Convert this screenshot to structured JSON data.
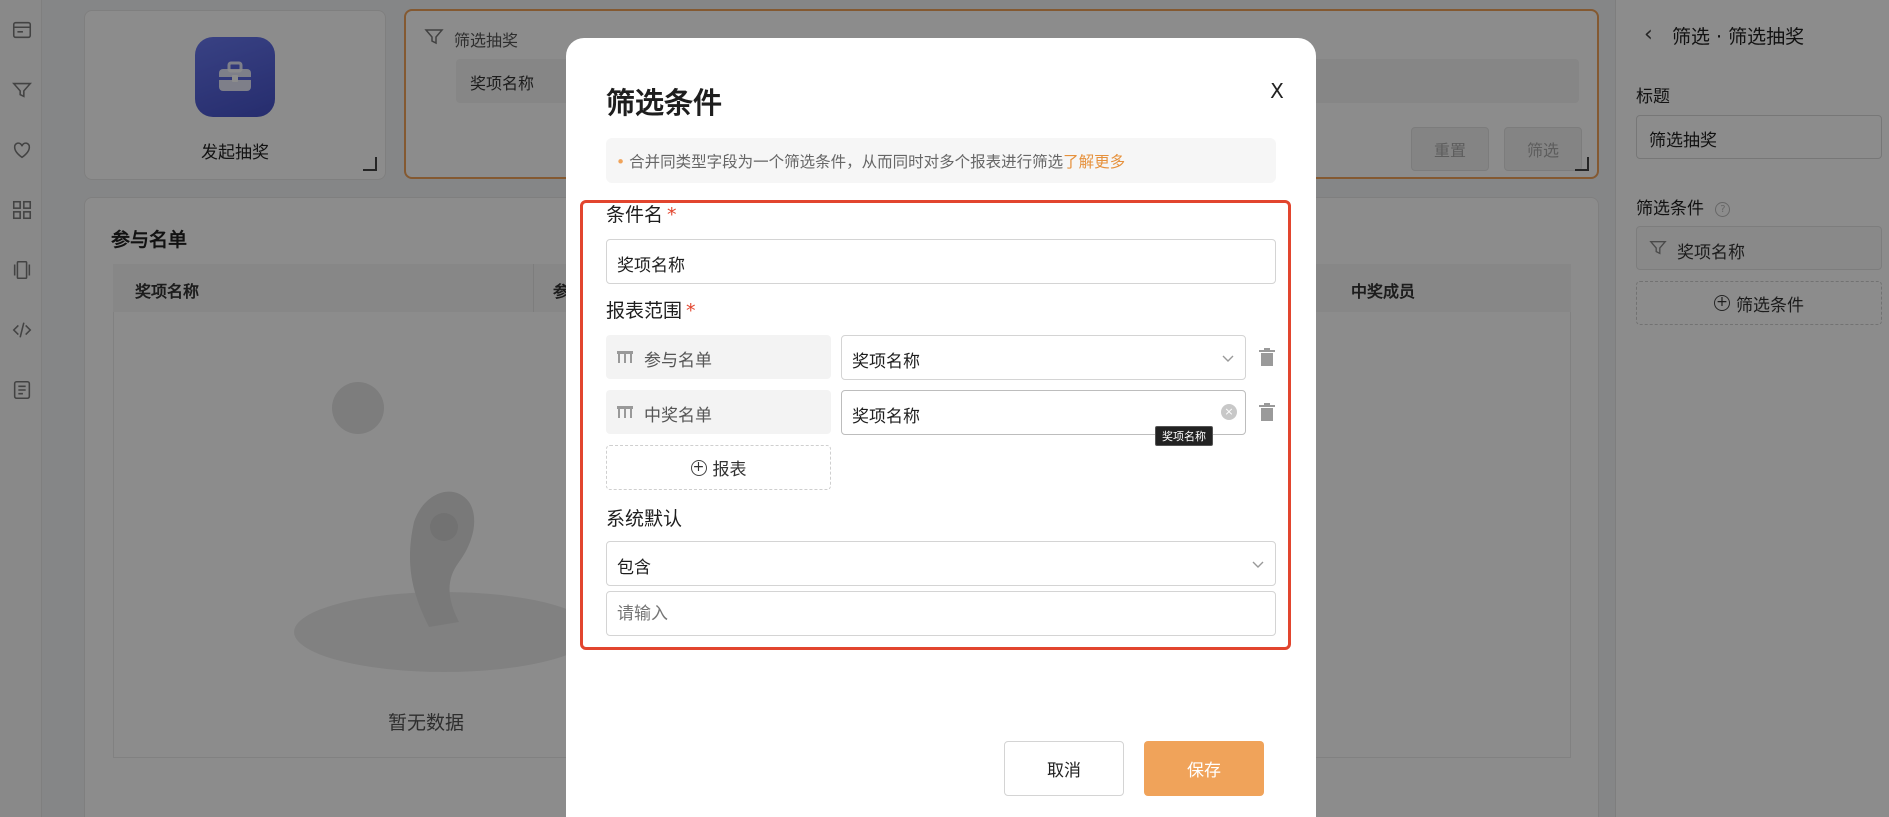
{
  "rail": {
    "icons": [
      "dashboard-icon",
      "funnel-icon",
      "heart-icon",
      "grid-icon",
      "layers-icon",
      "code-icon",
      "document-icon"
    ]
  },
  "canvas": {
    "launch_label": "发起抽奖",
    "filter_card": {
      "title": "筛选抽奖",
      "chip_label": "奖项名称",
      "reset_label": "重置",
      "filter_label": "筛选"
    },
    "list": {
      "title": "参与名单",
      "columns": [
        "奖项名称",
        "参",
        "中奖成员"
      ],
      "empty_text": "暂无数据"
    }
  },
  "right_panel": {
    "title": "筛选 · 筛选抽奖",
    "title_label": "标题",
    "title_value": "筛选抽奖",
    "conditions_label": "筛选条件",
    "condition_chip": "奖项名称",
    "add_condition": "筛选条件"
  },
  "modal": {
    "title": "筛选条件",
    "close": "X",
    "tip_text": "合并同类型字段为一个筛选条件，从而同时对多个报表进行筛选",
    "tip_link": "了解更多",
    "condition_name_label": "条件名",
    "condition_name_value": "奖项名称",
    "report_scope_label": "报表范围",
    "reports": [
      {
        "report": "参与名单",
        "field": "奖项名称"
      },
      {
        "report": "中奖名单",
        "field": "奖项名称"
      }
    ],
    "tooltip": "奖项名称",
    "add_report": "报表",
    "system_default_label": "系统默认",
    "operator_value": "包含",
    "value_placeholder": "请输入",
    "cancel_label": "取消",
    "save_label": "保存"
  },
  "colors": {
    "accent": "#f0a35a",
    "required": "#e2452e",
    "highlight_border": "#e2452e",
    "app_icon": "#5a66e0"
  }
}
